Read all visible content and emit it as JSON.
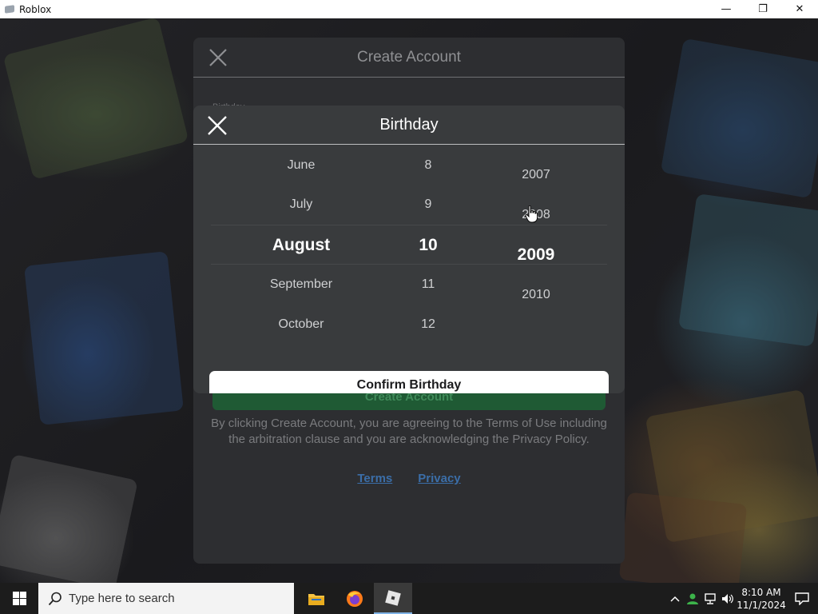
{
  "window": {
    "title": "Roblox",
    "minimize_glyph": "—",
    "restore_glyph": "❐",
    "close_glyph": "✕"
  },
  "create_account": {
    "title": "Create Account",
    "birthday_hint": "Birthday",
    "create_button": "Create Account",
    "terms_text": "By clicking Create Account, you are agreeing to the Terms of Use including the arbitration clause and you are acknowledging the Privacy Policy.",
    "terms_link": "Terms",
    "privacy_link": "Privacy"
  },
  "birthday_dialog": {
    "title": "Birthday",
    "months": [
      "June",
      "July",
      "August",
      "September",
      "October"
    ],
    "days": [
      "8",
      "9",
      "10",
      "11",
      "12"
    ],
    "years": [
      "2007",
      "2008",
      "2009",
      "2010"
    ],
    "selected_month": "August",
    "selected_day": "10",
    "selected_year": "2009",
    "confirm_button": "Confirm Birthday"
  },
  "taskbar": {
    "search_placeholder": "Type here to search",
    "time": "8:10 AM",
    "date": "11/1/2024",
    "apps": [
      "file-explorer",
      "firefox",
      "roblox"
    ]
  },
  "colors": {
    "accent_green": "#1f5a34",
    "link_blue": "#3b6ea8",
    "dialog_bg": "#393b3d",
    "panel_bg": "#2d2e31"
  }
}
